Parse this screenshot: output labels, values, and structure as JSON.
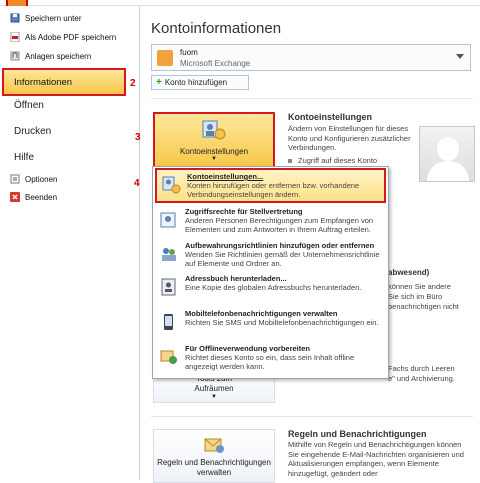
{
  "sidebar": {
    "commands": [
      {
        "label": "Speichern unter",
        "icon": "save-as-icon"
      },
      {
        "label": "Als Adobe PDF speichern",
        "icon": "pdf-icon"
      },
      {
        "label": "Anlagen speichern",
        "icon": "attachment-icon"
      }
    ],
    "selected": "Informationen",
    "callout_2": "2",
    "items": [
      "Öffnen",
      "Drucken",
      "Hilfe"
    ],
    "commands2": [
      {
        "label": "Optionen",
        "icon": "options-icon"
      },
      {
        "label": "Beenden",
        "icon": "exit-icon"
      }
    ]
  },
  "main": {
    "title": "Kontoinformationen",
    "account": {
      "name": "fuom",
      "type": "Microsoft Exchange"
    },
    "add_account": "Konto hinzufügen",
    "account_settings": {
      "button_label": "Kontoeinstellungen",
      "callout_3": "3",
      "title": "Kontoeinstellungen",
      "text": "Ändern von Einstellungen für dieses Konto und Konfigurieren zusätzlicher Verbindungen.",
      "bullet": "Zugriff auf dieses Konto"
    },
    "partial_right": {
      "abwesend": "abwesend)",
      "line1": "können Sie andere",
      "line2": "Sie sich im Büro",
      "line3": "benachrichtigen nicht",
      "line4": "Fachs durch Leeren",
      "line5": "e\" und Archivierung."
    },
    "cleanup_button": "Tools zum\nAufräumen",
    "rules": {
      "button": "Regeln und Benachrichtigungen verwalten",
      "title": "Regeln und Benachrichtigungen",
      "text": "Mithilfe von Regeln und Benachrichtigungen können Sie eingehende E-Mail-Nachrichten organisieren und Aktualisierungen empfangen, wenn Elemente hinzugefügt, geändert oder"
    }
  },
  "menu": {
    "callout_4": "4",
    "items": [
      {
        "title": "Kontoeinstellungen...",
        "desc": "Konten hinzufügen oder entfernen bzw. vorhandene Verbindungseinstellungen ändern.",
        "icon": "account-settings-icon"
      },
      {
        "title": "Zugriffsrechte für Stellvertretung",
        "desc": "Anderen Personen Berechtigungen zum Empfangen von Elementen und zum Antworten in Ihrem Auftrag erteilen.",
        "icon": "delegate-access-icon"
      },
      {
        "title": "Aufbewahrungsrichtlinien hinzufügen oder entfernen",
        "desc": "Wenden Sie Richtlinien gemäß der Unternehmensrichtlinie auf Elemente und Ordner an.",
        "icon": "retention-policy-icon"
      },
      {
        "title": "Adressbuch herunterladen...",
        "desc": "Eine Kopie des globalen Adressbuchs herunterladen.",
        "icon": "address-book-icon"
      },
      {
        "title": "Mobiltelefonbenachrichtigungen verwalten",
        "desc": "Richten Sie SMS und Mobiltelefonbenachrichtigungen ein.",
        "icon": "mobile-phone-icon"
      },
      {
        "title": "Für Offlineverwendung vorbereiten",
        "desc": "Richtet dieses Konto so ein, dass sein Inhalt offline angezeigt werden kann.",
        "icon": "offline-icon"
      }
    ]
  }
}
